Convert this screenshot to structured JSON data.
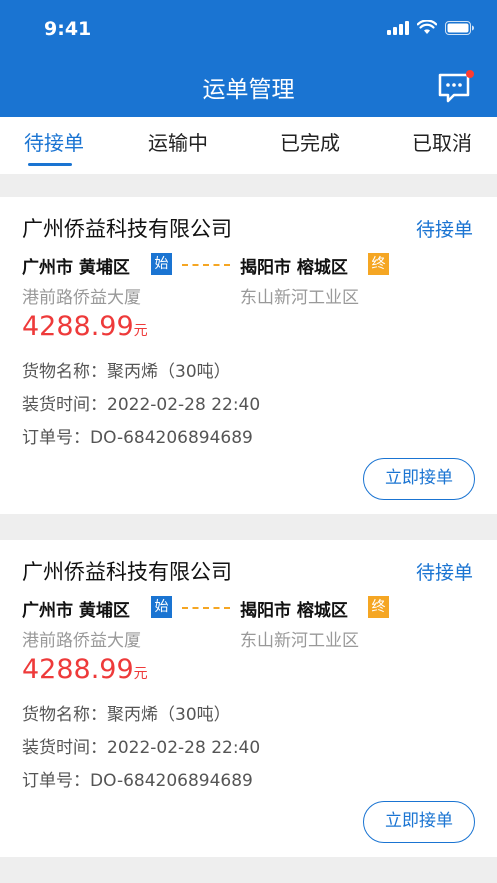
{
  "status_bar": {
    "time": "9:41"
  },
  "header": {
    "title": "运单管理"
  },
  "tabs": [
    {
      "label": "待接单",
      "active": true
    },
    {
      "label": "运输中",
      "active": false
    },
    {
      "label": "已完成",
      "active": false
    },
    {
      "label": "已取消",
      "active": false
    }
  ],
  "orders": [
    {
      "company": "广州侨益科技有限公司",
      "status": "待接单",
      "from": "广州市 黄埔区",
      "from_tag": "始",
      "to": "揭阳市 榕城区",
      "to_tag": "终",
      "from_address": "港前路侨益大厦",
      "to_address": "东山新河工业区",
      "price": "4288.99",
      "price_unit": "元",
      "goods": "货物名称：聚丙烯（30吨）",
      "load_time": "装货时间：2022-02-28 22:40",
      "order_no": "订单号：DO-684206894689",
      "action": "立即接单"
    },
    {
      "company": "广州侨益科技有限公司",
      "status": "待接单",
      "from": "广州市 黄埔区",
      "from_tag": "始",
      "to": "揭阳市 榕城区",
      "to_tag": "终",
      "from_address": "港前路侨益大厦",
      "to_address": "东山新河工业区",
      "price": "4288.99",
      "price_unit": "元",
      "goods": "货物名称：聚丙烯（30吨）",
      "load_time": "装货时间：2022-02-28 22:40",
      "order_no": "订单号：DO-684206894689",
      "action": "立即接单"
    }
  ],
  "colors": {
    "primary": "#1a74d2",
    "price": "#ee3a3a",
    "end_tag": "#f5a623",
    "notification_dot": "#ff3b30"
  },
  "icons": [
    "signal-icon",
    "wifi-icon",
    "battery-icon",
    "message-icon"
  ]
}
